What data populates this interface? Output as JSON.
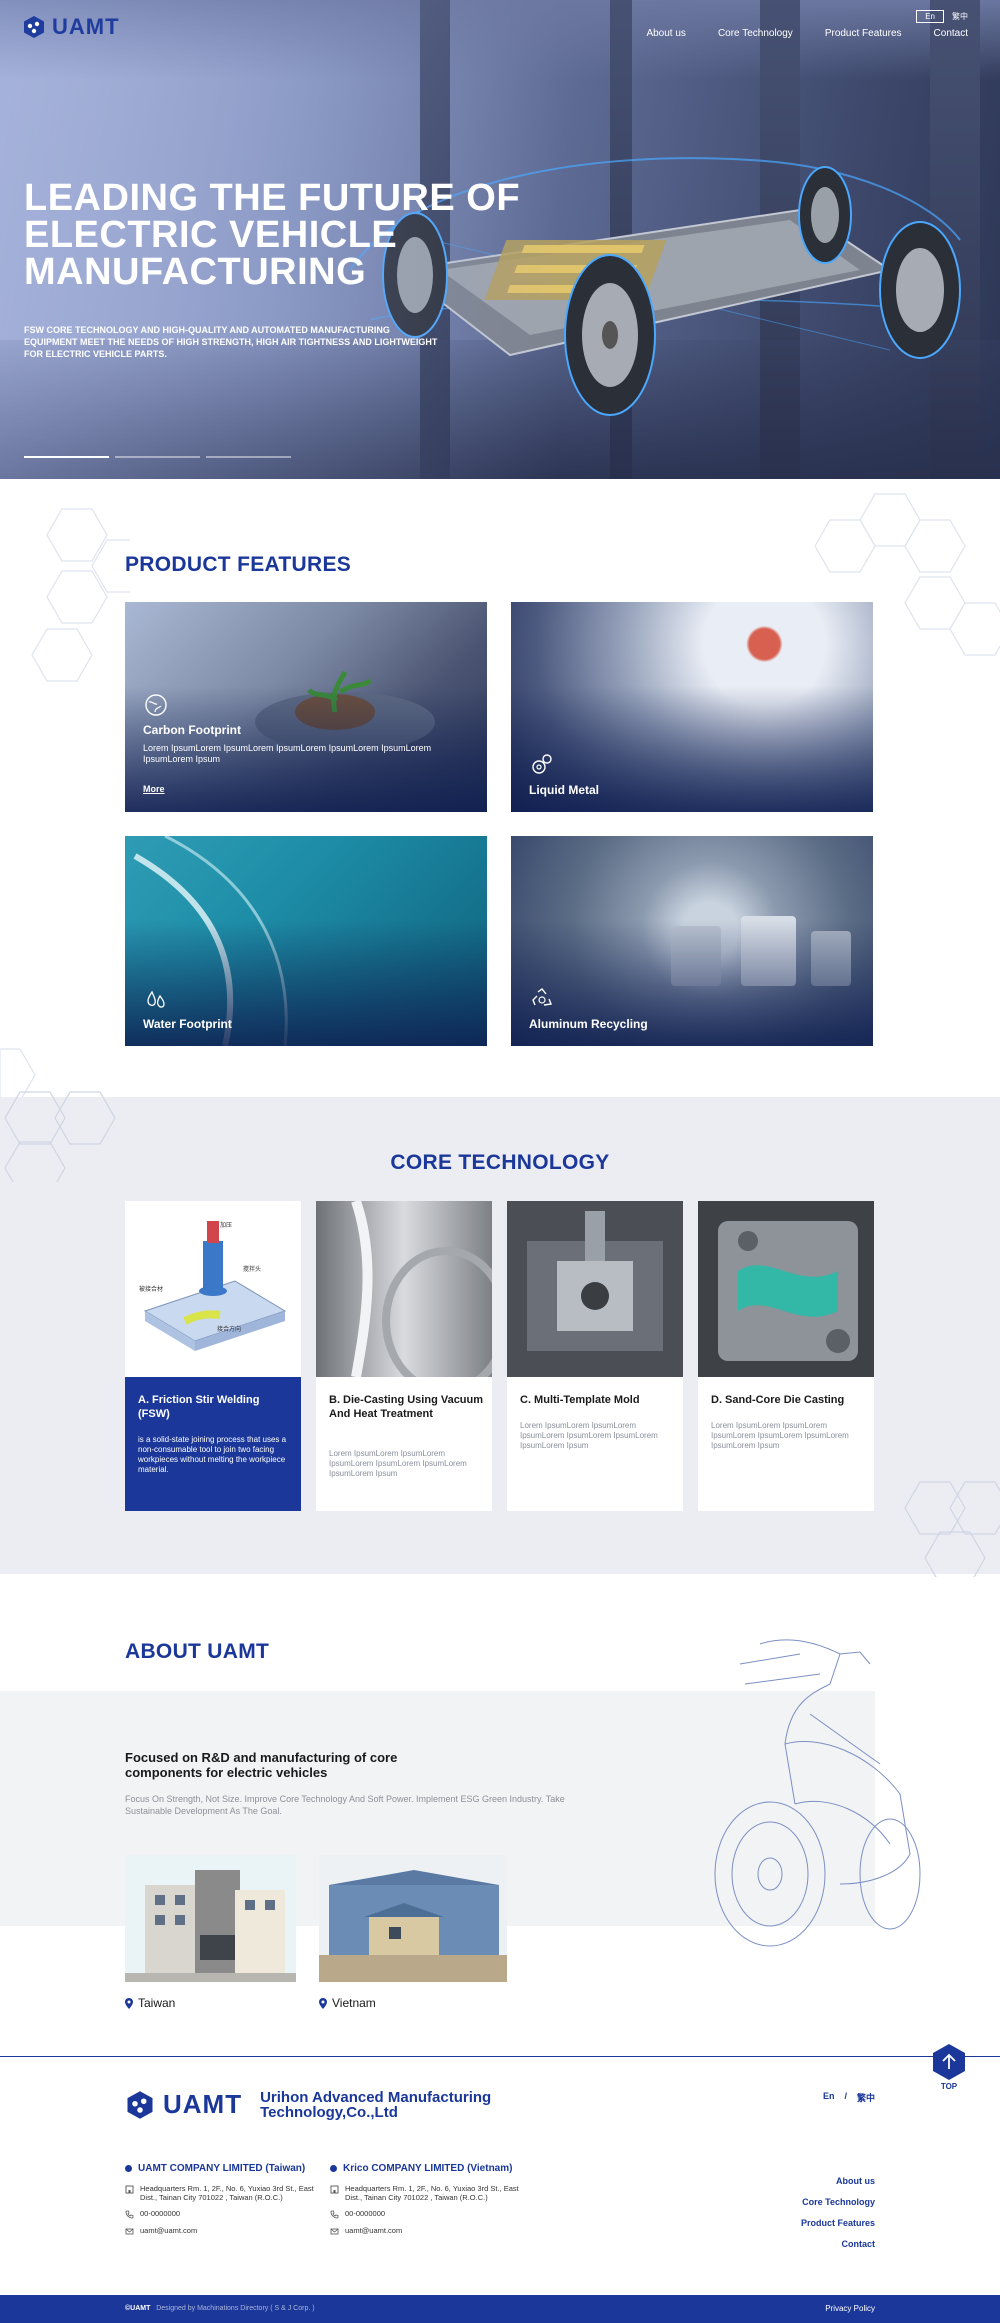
{
  "brand": {
    "name": "UAMT",
    "full_name": "Urihon Advanced Manufacturing Technology,Co.,Ltd",
    "accent": "#1a3799"
  },
  "header": {
    "nav": [
      "About us",
      "Core Technology",
      "Product Features",
      "Contact"
    ],
    "languages": [
      "En",
      "繁中"
    ],
    "active_language": "En"
  },
  "hero": {
    "title": "LEADING THE FUTURE OF ELECTRIC VEHICLE MANUFACTURING",
    "subtitle": "FSW CORE TECHNOLOGY AND HIGH-QUALITY AND AUTOMATED MANUFACTURING EQUIPMENT MEET THE NEEDS OF HIGH STRENGTH, HIGH AIR TIGHTNESS AND LIGHTWEIGHT FOR ELECTRIC VEHICLE PARTS.",
    "slides": 3,
    "active_slide": 1
  },
  "product_features": {
    "title": "PRODUCT FEATURES",
    "cards": [
      {
        "title": "Carbon Footprint",
        "icon": "globe-leaf-icon",
        "description": "Lorem IpsumLorem IpsumLorem IpsumLorem IpsumLorem IpsumLorem IpsumLorem Ipsum",
        "more": "More"
      },
      {
        "title": "Liquid Metal",
        "icon": "gears-icon"
      },
      {
        "title": "Water Footprint",
        "icon": "water-drops-icon"
      },
      {
        "title": "Aluminum Recycling",
        "icon": "recycle-icon"
      }
    ]
  },
  "core_technology": {
    "title": "CORE TECHNOLOGY",
    "cards": [
      {
        "title": "A. Friction Stir Welding (FSW)",
        "description": "is a solid-state joining process that uses a non-consumable tool to join two facing workpieces without melting the workpiece material.",
        "active": true
      },
      {
        "title": "B. Die-Casting Using Vacuum And Heat Treatment",
        "description": "Lorem IpsumLorem IpsumLorem IpsumLorem IpsumLorem IpsumLorem IpsumLorem Ipsum"
      },
      {
        "title": "C. Multi-Template Mold",
        "description": "Lorem IpsumLorem IpsumLorem IpsumLorem IpsumLorem IpsumLorem IpsumLorem Ipsum"
      },
      {
        "title": "D. Sand-Core Die Casting",
        "description": "Lorem IpsumLorem IpsumLorem IpsumLorem IpsumLorem IpsumLorem IpsumLorem Ipsum"
      }
    ]
  },
  "about": {
    "title": "ABOUT UAMT",
    "focus": "Focused on R&D and manufacturing of core components for electric vehicles",
    "intro": "Focus On Strength, Not Size. Improve Core Technology And Soft Power. Implement ESG Green Industry. Take Sustainable Development As The Goal.",
    "locations": [
      "Taiwan",
      "Vietnam"
    ]
  },
  "footer": {
    "top_label": "TOP",
    "offices": [
      {
        "name": "UAMT COMPANY LIMITED (Taiwan)",
        "address": "Headquarters Rm. 1, 2F., No. 6, Yuxiao 3rd St., East Dist., Tainan City 701022 , Taiwan (R.O.C.)",
        "phone": "00-0000000",
        "email": "uamt@uamt.com"
      },
      {
        "name": "Krico COMPANY LIMITED (Vietnam)",
        "address": "Headquarters Rm. 1, 2F., No. 6, Yuxiao 3rd St., East Dist., Tainan City 701022 , Taiwan (R.O.C.)",
        "phone": "00-0000000",
        "email": "uamt@uamt.com"
      }
    ],
    "nav": [
      "About us",
      "Core Technology",
      "Product Features",
      "Contact"
    ],
    "languages": [
      "En",
      "/",
      "繁中"
    ],
    "copyright": "©UAMT",
    "designer": "Designed by Machinations Directory ( S & J Corp. )",
    "privacy": "Privacy Policy"
  }
}
